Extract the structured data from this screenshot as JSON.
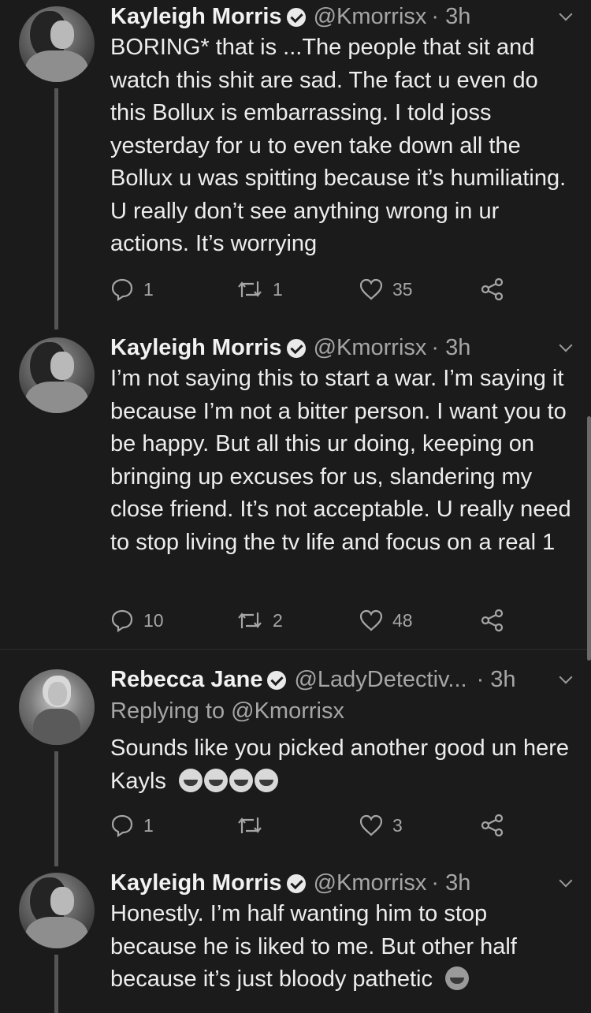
{
  "tweets": [
    {
      "name": "Kayleigh Morris",
      "handle": "@Kmorrisx",
      "time": "· 3h",
      "reply_to": "",
      "text": "BORING* that is ...The people that sit and watch this shit are sad. The fact u even do this Bollux is embarrassing. I told joss yesterday for u to even take down all the Bollux u was spitting because it’s humiliating. U really don’t see anything wrong in ur actions. It’s worrying",
      "replies": "1",
      "retweets": "1",
      "likes": "35"
    },
    {
      "name": "Kayleigh Morris",
      "handle": "@Kmorrisx",
      "time": "· 3h",
      "reply_to": "",
      "text": "I’m not saying this to start a war. I’m saying it because I’m not a bitter person. I want you to be happy. But all this ur doing, keeping on bringing up excuses for us, slandering my close friend. It’s not acceptable. U really need to stop living the tv life and focus on a real 1",
      "replies": "10",
      "retweets": "2",
      "likes": "48"
    },
    {
      "name": "Rebecca Jane",
      "handle": "@LadyDetectiv...",
      "time": "· 3h",
      "reply_to": "Replying to @Kmorrisx",
      "text": "Sounds like you picked another good un here Kayls",
      "emojis": [
        "face-with-tears-of-joy",
        "face-with-tears-of-joy",
        "face-with-tears-of-joy",
        "face-with-tears-of-joy"
      ],
      "replies": "1",
      "retweets": "",
      "likes": "3"
    },
    {
      "name": "Kayleigh Morris",
      "handle": "@Kmorrisx",
      "time": "· 3h",
      "reply_to": "",
      "text": "Honestly. I’m half wanting him to stop because he is liked to me. But other half because it’s just bloody pathetic",
      "emojis": [
        "person-facepalming"
      ]
    }
  ],
  "colors": {
    "background": "#1b1b1b",
    "text": "#ededed",
    "secondary": "#a6a6a6",
    "thread_line": "#555555"
  }
}
